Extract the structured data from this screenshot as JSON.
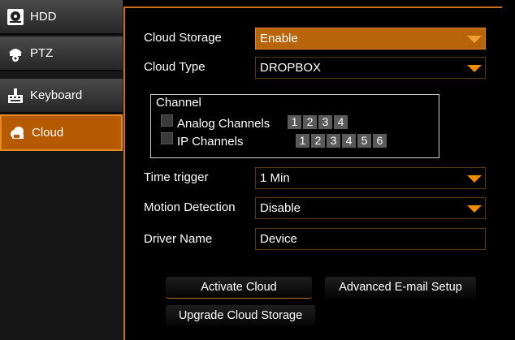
{
  "sidebar": {
    "items": [
      {
        "label": "HDD",
        "icon": "hdd-icon"
      },
      {
        "label": "PTZ",
        "icon": "ptz-camera-icon"
      },
      {
        "label": "Keyboard",
        "icon": "keyboard-icon"
      },
      {
        "label": "Cloud",
        "icon": "cloud-icon",
        "active": true
      }
    ]
  },
  "form": {
    "cloud_storage": {
      "label": "Cloud Storage",
      "value": "Enable"
    },
    "cloud_type": {
      "label": "Cloud Type",
      "value": "DROPBOX"
    },
    "channel": {
      "legend": "Channel",
      "analog": {
        "label": "Analog Channels",
        "numbers": [
          "1",
          "2",
          "3",
          "4"
        ]
      },
      "ip": {
        "label": "IP Channels",
        "numbers": [
          "1",
          "2",
          "3",
          "4",
          "5",
          "6"
        ]
      }
    },
    "time_trigger": {
      "label": "Time trigger",
      "value": "1 Min"
    },
    "motion_detection": {
      "label": "Motion Detection",
      "value": "Disable"
    },
    "driver_name": {
      "label": "Driver Name",
      "value": "Device"
    }
  },
  "buttons": {
    "activate_cloud": "Activate Cloud",
    "advanced_email": "Advanced E-mail Setup",
    "upgrade_cloud": "Upgrade Cloud Storage"
  },
  "colors": {
    "accent": "#b8640a",
    "caret": "#f08c00"
  }
}
